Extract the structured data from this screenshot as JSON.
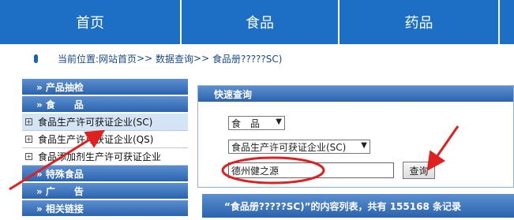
{
  "nav": {
    "home": "首页",
    "food": "食品",
    "drug": "药品"
  },
  "breadcrumb": {
    "prefix": "当前位置:",
    "home": "网站首页",
    "sep1": ">>",
    "query": "数据查询",
    "sep2": ">>",
    "current": "食品册?????SC)"
  },
  "menu": {
    "cat_inspection": "» 产品抽检",
    "cat_food": "» 食　　品",
    "sub_items": [
      "食品生产许可获证企业(SC)",
      "食品生产许可获证企业(QS)",
      "食品添加剂生产许可获证企业"
    ],
    "cat_special": "» 特殊食品",
    "cat_ads": "» 广　　告",
    "cat_links": "» 相关链接"
  },
  "quick": {
    "title": "快速查询",
    "category_value": "食　品",
    "type_value": "食品生产许可获证企业(SC)",
    "keyword_value": "德州健之源",
    "button": "查询"
  },
  "result": {
    "text": "“食品册?????SC)”的内容列表，共有 155168 条记录"
  },
  "colors": {
    "nav_blue": "#1c6fc4",
    "annotation_red": "#e02020"
  }
}
